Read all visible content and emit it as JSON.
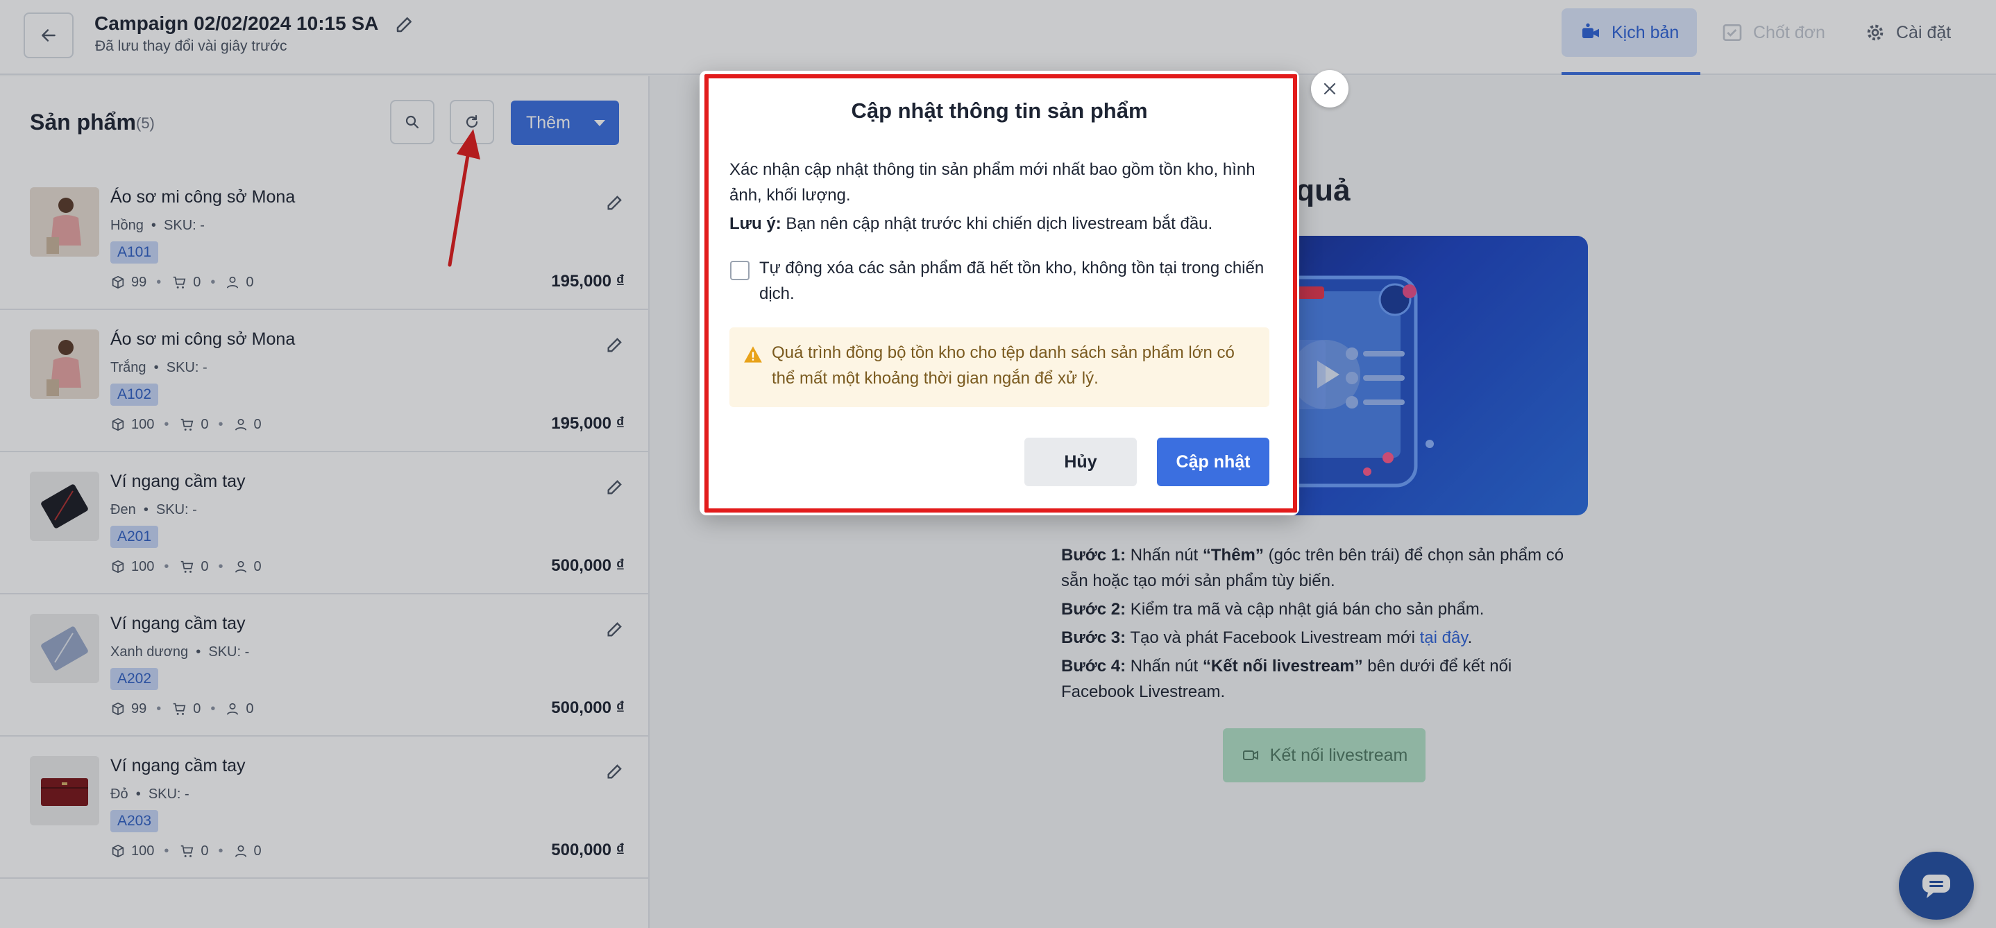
{
  "header": {
    "title": "Campaign 02/02/2024 10:15 SA",
    "subtitle": "Đã lưu thay đổi vài giây trước",
    "tabs": [
      {
        "label": "Kịch bản",
        "icon": "video-camera-icon",
        "active": true
      },
      {
        "label": "Chốt đơn",
        "icon": "checklist-icon",
        "active": false
      },
      {
        "label": "Cài đặt",
        "icon": "gear-icon",
        "active": false
      }
    ]
  },
  "products_panel": {
    "title": "Sản phẩm",
    "count": "(5)",
    "add_label": "Thêm",
    "items": [
      {
        "name": "Áo sơ mi công sở Mona",
        "variant": "Hồng",
        "sku": "SKU: -",
        "tag": "A101",
        "stock": "99",
        "cart": "0",
        "users": "0",
        "price": "195,000 ₫"
      },
      {
        "name": "Áo sơ mi công sở Mona",
        "variant": "Trắng",
        "sku": "SKU: -",
        "tag": "A102",
        "stock": "100",
        "cart": "0",
        "users": "0",
        "price": "195,000 ₫"
      },
      {
        "name": "Ví ngang cầm tay",
        "variant": "Đen",
        "sku": "SKU: -",
        "tag": "A201",
        "stock": "100",
        "cart": "0",
        "users": "0",
        "price": "500,000 ₫"
      },
      {
        "name": "Ví ngang cầm tay",
        "variant": "Xanh dương",
        "sku": "SKU: -",
        "tag": "A202",
        "stock": "99",
        "cart": "0",
        "users": "0",
        "price": "500,000 ₫"
      },
      {
        "name": "Ví ngang cầm tay",
        "variant": "Đỏ",
        "sku": "SKU: -",
        "tag": "A203",
        "stock": "100",
        "cart": "0",
        "users": "0",
        "price": "500,000 ₫"
      }
    ]
  },
  "main": {
    "headline": "Livestream hiệu quả",
    "steps": [
      {
        "label": "Bước 1:",
        "text_before": " Nhấn nút ",
        "strong": "“Thêm”",
        "text_after": " (góc trên bên trái) để chọn sản phẩm có sẵn hoặc tạo mới sản phẩm tùy biến."
      },
      {
        "label": "Bước 2:",
        "text": " Kiểm tra mã và cập nhật giá bán cho sản phẩm."
      },
      {
        "label": "Bước 3:",
        "text": " Tạo và phát Facebook Livestream mới ",
        "link": "tại đây",
        "end": "."
      },
      {
        "label": "Bước 4:",
        "text_before": " Nhấn nút ",
        "strong": "“Kết nối livestream”",
        "text_after": " bên dưới để kết nối Facebook Livestream."
      }
    ],
    "connect_label": "Kết nối livestream"
  },
  "modal": {
    "title": "Cập nhật thông tin sản phẩm",
    "description": "Xác nhận cập nhật thông tin sản phẩm mới nhất bao gồm tồn kho, hình ảnh, khối lượng.",
    "note_label": "Lưu ý:",
    "note_text": " Bạn nên cập nhật trước khi chiến dịch livestream bắt đầu.",
    "checkbox_label": "Tự động xóa các sản phẩm đã hết tồn kho, không tồn tại trong chiến dịch.",
    "warning": "Quá trình đồng bộ tồn kho cho tệp danh sách sản phẩm lớn có thể mất một khoảng thời gian ngắn để xử lý.",
    "cancel_label": "Hủy",
    "confirm_label": "Cập nhật"
  },
  "colors": {
    "primary": "#3b6fe0",
    "highlight": "#e21b1b",
    "warning_bg": "#fdf5e4",
    "success": "#52b985"
  }
}
